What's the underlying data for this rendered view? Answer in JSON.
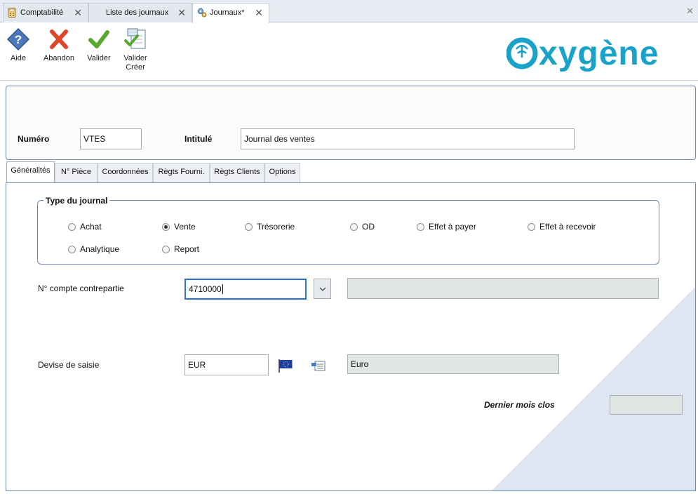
{
  "doc_tabs": [
    {
      "label": "Comptabilité",
      "icon": "calculator-icon"
    },
    {
      "label": "Liste des journaux"
    },
    {
      "label": "Journaux*",
      "icon": "gears-icon"
    }
  ],
  "toolbar": {
    "help": "Aide",
    "abandon": "Abandon",
    "validate": "Valider",
    "validate_create_1": "Valider",
    "validate_create_2": "Créer"
  },
  "logo_text": "oxygène",
  "header": {
    "numero_label": "Numéro",
    "numero_value": "VTES",
    "intitule_label": "Intitulé",
    "intitule_value": "Journal des ventes"
  },
  "form_tabs": [
    "Généralités",
    "N° Pièce",
    "Coordonnées",
    "Règts Fourni.",
    "Règts Clients",
    "Options"
  ],
  "journal_type": {
    "title": "Type du journal",
    "options": [
      "Achat",
      "Vente",
      "Trésorerie",
      "OD",
      "Effet à payer",
      "Effet à recevoir",
      "Analytique",
      "Report"
    ],
    "selected": "Vente"
  },
  "contrepartie": {
    "label": "N° compte contrepartie",
    "value": "4710000",
    "description": ""
  },
  "devise": {
    "label": "Devise de saisie",
    "value": "EUR",
    "description": "Euro"
  },
  "dernier_mois": {
    "label": "Dernier mois clos",
    "value": ""
  },
  "colors": {
    "accent": "#6a89b6",
    "logo": "#1aa3c9",
    "abandon_red": "#e0452b",
    "valider_green": "#58a82e"
  }
}
